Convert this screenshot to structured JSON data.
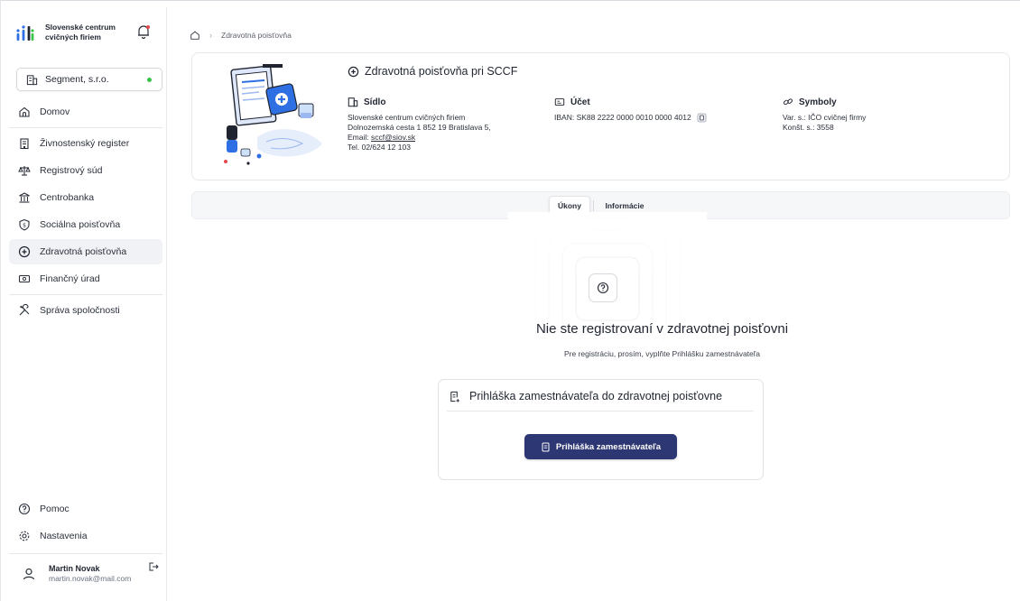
{
  "brand": {
    "name_line1": "Slovenské centrum",
    "name_line2": "cvičných firiem"
  },
  "company": {
    "name": "Segment, s.r.o.",
    "status_color": "#3ac34a"
  },
  "nav": {
    "items": [
      {
        "label": "Domov",
        "icon": "home-icon"
      },
      {
        "label": "Živnostenský register",
        "icon": "building-icon"
      },
      {
        "label": "Registrový súd",
        "icon": "scales-icon"
      },
      {
        "label": "Centrobanka",
        "icon": "bank-icon"
      },
      {
        "label": "Sociálna poisťovňa",
        "icon": "shield-coin-icon"
      },
      {
        "label": "Zdravotná poisťovňa",
        "icon": "health-icon",
        "active": true
      },
      {
        "label": "Finančný úrad",
        "icon": "money-icon"
      }
    ],
    "tools": [
      {
        "label": "Správa spoločnosti",
        "icon": "tools-icon"
      }
    ],
    "bottom": [
      {
        "label": "Pomoc",
        "icon": "help-icon"
      },
      {
        "label": "Nastavenia",
        "icon": "settings-icon"
      }
    ]
  },
  "user": {
    "name": "Martin Novak",
    "email": "martin.novak@mail.com"
  },
  "breadcrumb": {
    "current": "Zdravotná poisťovňa"
  },
  "institution": {
    "title": "Zdravotná poisťovňa pri SCCF",
    "sidlo": {
      "heading": "Sídlo",
      "line1": "Slovenské centrum cvičných firiem",
      "line2": "Dolnozemská cesta 1 852 19 Bratislava 5,",
      "email_label": "Email:",
      "email": "sccf@siov.sk",
      "phone": "Tel. 02/624 12 103"
    },
    "ucet": {
      "heading": "Účet",
      "iban_label": "IBAN:",
      "iban": "SK88 2222 0000 0010 0000 4012"
    },
    "symboly": {
      "heading": "Symboly",
      "var": "Var. s.: IČO cvičnej firmy",
      "konst": "Konšt. s.: 3558"
    }
  },
  "tabs": [
    {
      "label": "Úkony",
      "active": true
    },
    {
      "label": "Informácie"
    }
  ],
  "empty": {
    "title": "Nie ste registrovaní v zdravotnej poisťovni",
    "subtitle": "Pre registráciu, prosím, vyplňte Prihlášku zamestnávateľa"
  },
  "application": {
    "heading": "Prihláška zamestnávateľa do zdravotnej poisťovne",
    "button": "Prihláška zamestnávateľa"
  },
  "colors": {
    "primary": "#2d3773",
    "accent_red": "#e5484d",
    "blue": "#2f6fe4"
  }
}
